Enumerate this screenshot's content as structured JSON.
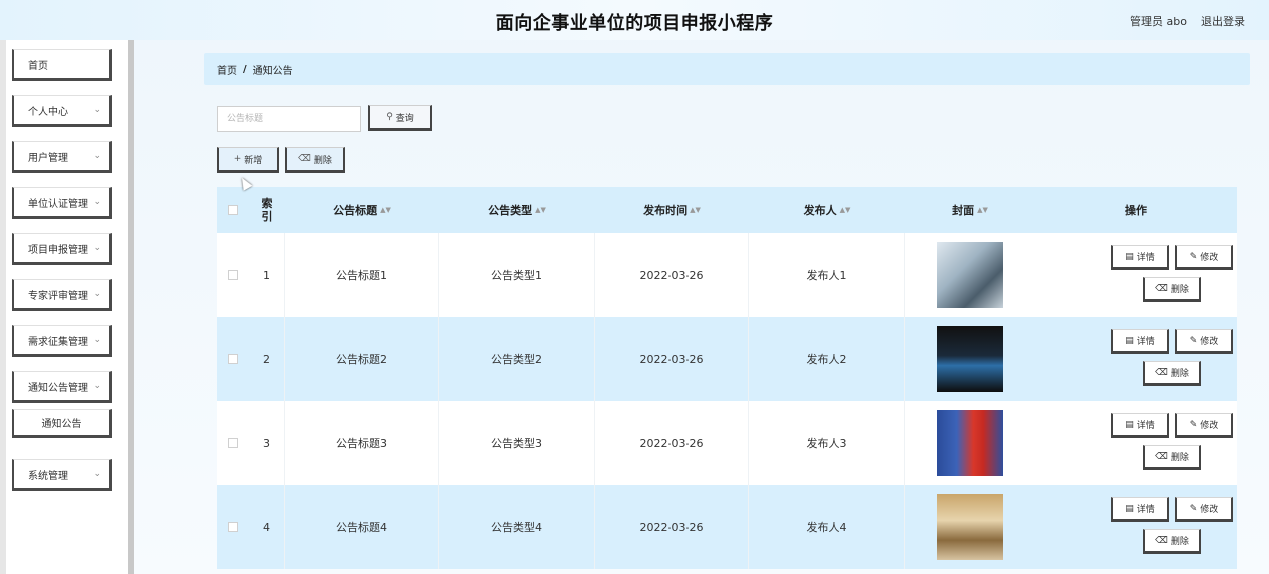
{
  "header": {
    "title": "面向企事业单位的项目申报小程序",
    "user": "管理员 abo",
    "logout": "退出登录"
  },
  "sidebar": {
    "items": [
      {
        "label": "首页",
        "expandable": false
      },
      {
        "label": "个人中心",
        "expandable": true
      },
      {
        "label": "用户管理",
        "expandable": true
      },
      {
        "label": "单位认证管理",
        "expandable": true
      },
      {
        "label": "项目申报管理",
        "expandable": true
      },
      {
        "label": "专家评审管理",
        "expandable": true
      },
      {
        "label": "需求征集管理",
        "expandable": true
      },
      {
        "label": "通知公告管理",
        "expandable": true
      },
      {
        "label": "通知公告",
        "expandable": false,
        "sub": true
      },
      {
        "label": "系统管理",
        "expandable": true
      }
    ]
  },
  "breadcrumb": {
    "home": "首页",
    "separator": "/",
    "current": "通知公告"
  },
  "search": {
    "placeholder": "公告标题",
    "button": "查询",
    "button_icon": "search-icon"
  },
  "toolbar": {
    "add_label": "新增",
    "add_icon": "plus-icon",
    "delete_label": "删除",
    "delete_icon": "trash-icon"
  },
  "table": {
    "columns": {
      "index": "索引",
      "title": "公告标题",
      "type": "公告类型",
      "time": "发布时间",
      "author": "发布人",
      "cover": "封面",
      "ops": "操作"
    },
    "rows": [
      {
        "index": "1",
        "title": "公告标题1",
        "type": "公告类型1",
        "time": "2022-03-26",
        "author": "发布人1"
      },
      {
        "index": "2",
        "title": "公告标题2",
        "type": "公告类型2",
        "time": "2022-03-26",
        "author": "发布人2"
      },
      {
        "index": "3",
        "title": "公告标题3",
        "type": "公告类型3",
        "time": "2022-03-26",
        "author": "发布人3"
      },
      {
        "index": "4",
        "title": "公告标题4",
        "type": "公告类型4",
        "time": "2022-03-26",
        "author": "发布人4"
      }
    ],
    "row_ops": {
      "detail": "详情",
      "edit": "修改",
      "delete": "删除"
    }
  },
  "colors": {
    "header_bg": "#e3f3fd",
    "breadcrumb_bg": "#d8effd",
    "row_even_bg": "#d8effd",
    "border_dark": "#444444"
  }
}
